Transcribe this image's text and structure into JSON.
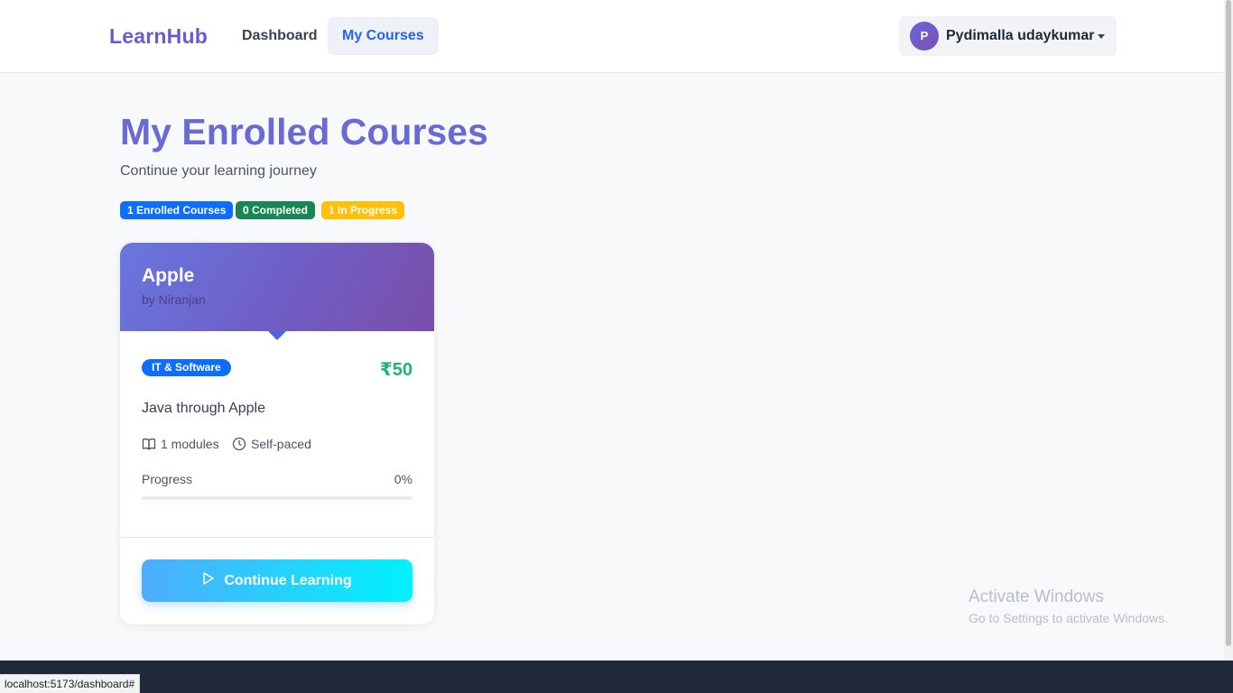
{
  "navbar": {
    "brand": "LearnHub",
    "links": [
      {
        "label": "Dashboard",
        "active": false
      },
      {
        "label": "My Courses",
        "active": true
      }
    ],
    "user": {
      "avatar_initial": "P",
      "name": "Pydimalla udaykumar"
    }
  },
  "page": {
    "title": "My Enrolled Courses",
    "subtitle": "Continue your learning journey",
    "badges": {
      "enrolled": "1 Enrolled Courses",
      "completed": "0 Completed",
      "in_progress": "1 In Progress"
    }
  },
  "courses": [
    {
      "title": "Apple",
      "instructor": "by Niranjan",
      "category": "IT & Software",
      "price": "₹50",
      "description": "Java through Apple",
      "modules": "1 modules",
      "pace": "Self-paced",
      "progress_label": "Progress",
      "progress_text": "0%",
      "progress_fraction": 0,
      "button_label": "Continue Learning"
    }
  ],
  "watermark": {
    "title": "Activate Windows",
    "subtitle": "Go to Settings to activate Windows."
  },
  "status_bar": {
    "url": "localhost:5173/dashboard#"
  },
  "colors": {
    "brand": "#6b5bd2",
    "primary": "#0d6efd",
    "success": "#198754",
    "warning": "#ffc107",
    "price": "#20b27a"
  },
  "icons": {
    "modules": "book-icon",
    "pace": "clock-icon",
    "continue": "play-icon",
    "user_menu": "caret-down-icon"
  }
}
